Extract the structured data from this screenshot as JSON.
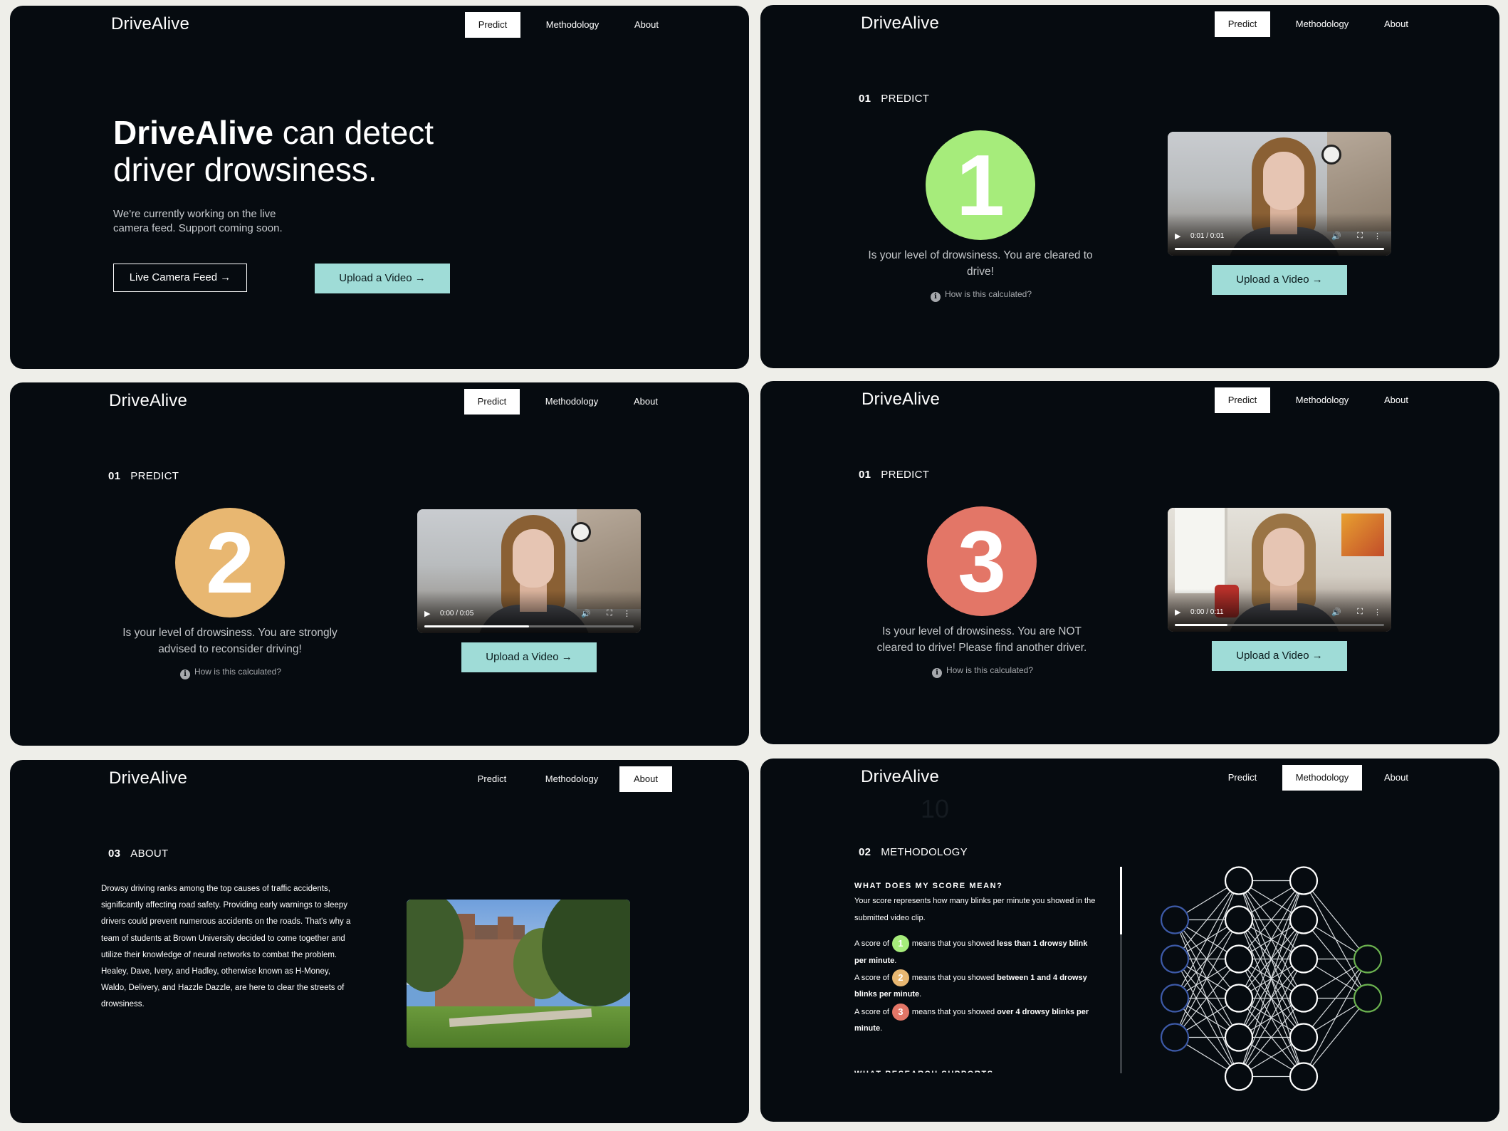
{
  "brand": "DriveAlive",
  "nav": {
    "predict": "Predict",
    "methodology": "Methodology",
    "about": "About"
  },
  "hero": {
    "title_bold": "DriveAlive",
    "title_rest": " can detect driver drowsiness.",
    "description": "We're currently working on the live camera feed. Support coming soon.",
    "live_button": "Live Camera Feed →",
    "upload_button": "Upload a Video →"
  },
  "predict": {
    "section_number": "01",
    "section_label": "PREDICT",
    "how_link": "How is this calculated?",
    "upload_button": "Upload a Video →",
    "results": [
      {
        "score": "1",
        "color": "#a6ec7b",
        "message": "Is your level of drowsiness. You are cleared to drive!",
        "video_time": "0:01 / 0:01",
        "progress": 1.0
      },
      {
        "score": "2",
        "color": "#e8b771",
        "message": "Is your level of drowsiness. You are strongly advised to reconsider driving!",
        "video_time": "0:00 / 0:05",
        "progress": 0.5
      },
      {
        "score": "3",
        "color": "#e37667",
        "message": "Is your level of drowsiness. You are NOT cleared to drive! Please find another driver.",
        "video_time": "0:00 / 0:11",
        "progress": 0.25
      }
    ]
  },
  "about": {
    "section_number": "03",
    "section_label": "ABOUT",
    "text": "Drowsy driving ranks among the top causes of traffic accidents, significantly affecting road safety. Providing early warnings to sleepy drivers could prevent numerous accidents on the roads. That's why a team of students at Brown University decided to come together and utilize their knowledge of neural networks to combat the problem. Healey, Dave, Ivery, and Hadley, otherwise known as H-Money, Waldo, Delivery, and Hazzle Dazzle, are here to clear the streets of drowsiness."
  },
  "methodology": {
    "section_number": "02",
    "section_label": "METHODOLOGY",
    "ghost_number": "10",
    "question": "WHAT DOES MY SCORE MEAN?",
    "intro": "Your score represents how many blinks per minute you showed in the submitted video clip.",
    "score_prefix": "A score of",
    "score_mid": "means that you showed",
    "score_lines": [
      {
        "score": "1",
        "bold": "less than 1 drowsy blink per minute",
        "end": "."
      },
      {
        "score": "2",
        "bold": "between 1 and 4 drowsy blinks per minute",
        "end": "."
      },
      {
        "score": "3",
        "bold": "over 4 drowsy blinks per minute",
        "end": "."
      }
    ],
    "next_question": "WHAT RESEARCH SUPPORTS THIS?",
    "network": {
      "input_nodes": 4,
      "hidden_layers": [
        6,
        6
      ],
      "output_nodes": 2,
      "input_color": "#3d5aa8",
      "hidden_color": "#ffffff",
      "output_color": "#6bb24f"
    }
  }
}
